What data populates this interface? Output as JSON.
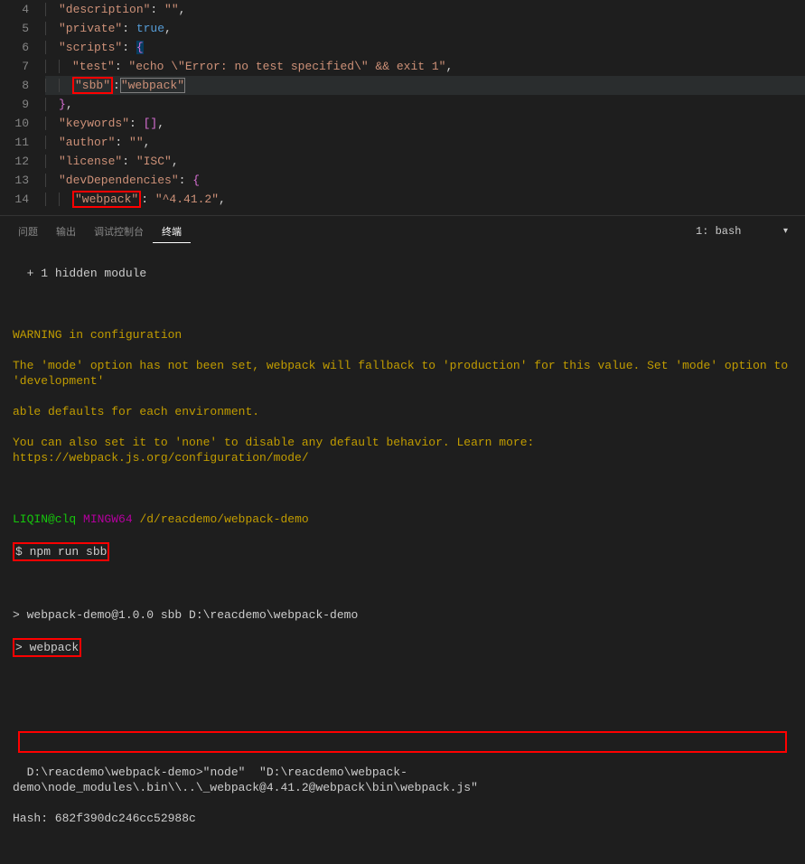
{
  "editor": {
    "lines": [
      4,
      5,
      6,
      7,
      8,
      9,
      10,
      11,
      12,
      13,
      14
    ],
    "json": {
      "description": "\"\"",
      "private": "true",
      "scripts_open": "{",
      "test_key": "\"test\"",
      "test_val": "\"echo \\\"Error: no test specified\\\" && exit 1\"",
      "sbb_key": "\"sbb\"",
      "sbb_val": "\"webpack\"",
      "scripts_close": "}",
      "keywords": "[]",
      "author": "\"\"",
      "license": "\"ISC\"",
      "devdeps_open": "{",
      "webpack_key": "\"webpack\"",
      "webpack_val": "\"^4.41.2\""
    }
  },
  "panel": {
    "tabs": {
      "problems": "问题",
      "output": "输出",
      "debug": "调试控制台",
      "terminal": "终端"
    },
    "selector": "1: bash"
  },
  "terminal": {
    "hidden": "+ 1 hidden module",
    "warn1": "WARNING in configuration",
    "warn2": "The 'mode' option has not been set, webpack will fallback to 'production' for this value. Set 'mode' option to 'development'",
    "warn3": "able defaults for each environment.",
    "warn4": "You can also set it to 'none' to disable any default behavior. Learn more: https://webpack.js.org/configuration/mode/",
    "prompt_user": "LIQIN@clq",
    "prompt_sys": "MINGW64",
    "prompt_path": "/d/reacdemo/webpack-demo",
    "prompt_sym": "$",
    "cmd": "npm run sbb",
    "out1": "> webpack-demo@1.0.0 sbb D:\\reacdemo\\webpack-demo",
    "out2": "> webpack",
    "out3": "D:\\reacdemo\\webpack-demo>\"node\"  \"D:\\reacdemo\\webpack-demo\\node_modules\\.bin\\\\..\\_webpack@4.41.2@webpack\\bin\\webpack.js\"",
    "out4": "Hash: 682f390dc246cc52988c"
  }
}
